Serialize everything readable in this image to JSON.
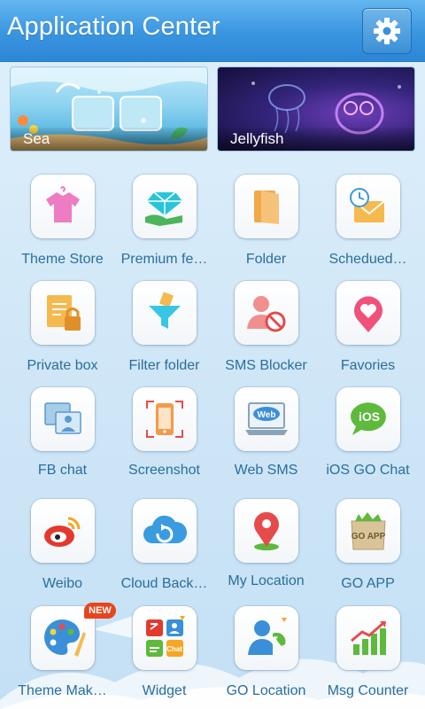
{
  "header": {
    "title": "Application Center"
  },
  "banners": [
    {
      "label": "Sea"
    },
    {
      "label": "Jellyfish"
    }
  ],
  "apps": [
    {
      "label": "Theme Store",
      "icon": "shirt-icon"
    },
    {
      "label": "Premium fe…",
      "icon": "diamond-icon"
    },
    {
      "label": "Folder",
      "icon": "folder-icon"
    },
    {
      "label": "Schedued…",
      "icon": "scheduled-mail-icon"
    },
    {
      "label": "Private box",
      "icon": "lock-box-icon"
    },
    {
      "label": "Filter folder",
      "icon": "funnel-icon"
    },
    {
      "label": "SMS Blocker",
      "icon": "user-block-icon"
    },
    {
      "label": "Favories",
      "icon": "heart-pin-icon"
    },
    {
      "label": "FB chat",
      "icon": "photo-chat-icon"
    },
    {
      "label": "Screenshot",
      "icon": "phone-capture-icon"
    },
    {
      "label": "Web SMS",
      "icon": "web-laptop-icon"
    },
    {
      "label": "iOS GO Chat",
      "icon": "ios-bubble-icon"
    },
    {
      "label": "Weibo",
      "icon": "weibo-icon"
    },
    {
      "label": "Cloud Back…",
      "icon": "cloud-sync-icon"
    },
    {
      "label": "My Location",
      "icon": "map-pin-icon"
    },
    {
      "label": "GO APP",
      "icon": "go-app-bag-icon"
    },
    {
      "label": "Theme Mak…",
      "icon": "palette-icon",
      "badge": "NEW"
    },
    {
      "label": "Widget",
      "icon": "widget-grid-icon"
    },
    {
      "label": "GO Location",
      "icon": "location-call-icon"
    },
    {
      "label": "Msg Counter",
      "icon": "bar-chart-icon"
    }
  ],
  "badges": {
    "new": "NEW"
  },
  "icon_text": {
    "web": "Web",
    "ios": "iOS",
    "goapp": "GO APP",
    "chat": "Chat"
  },
  "colors": {
    "header": "#3a95e0",
    "label": "#2a6e9c",
    "badge": "#e8451d"
  }
}
